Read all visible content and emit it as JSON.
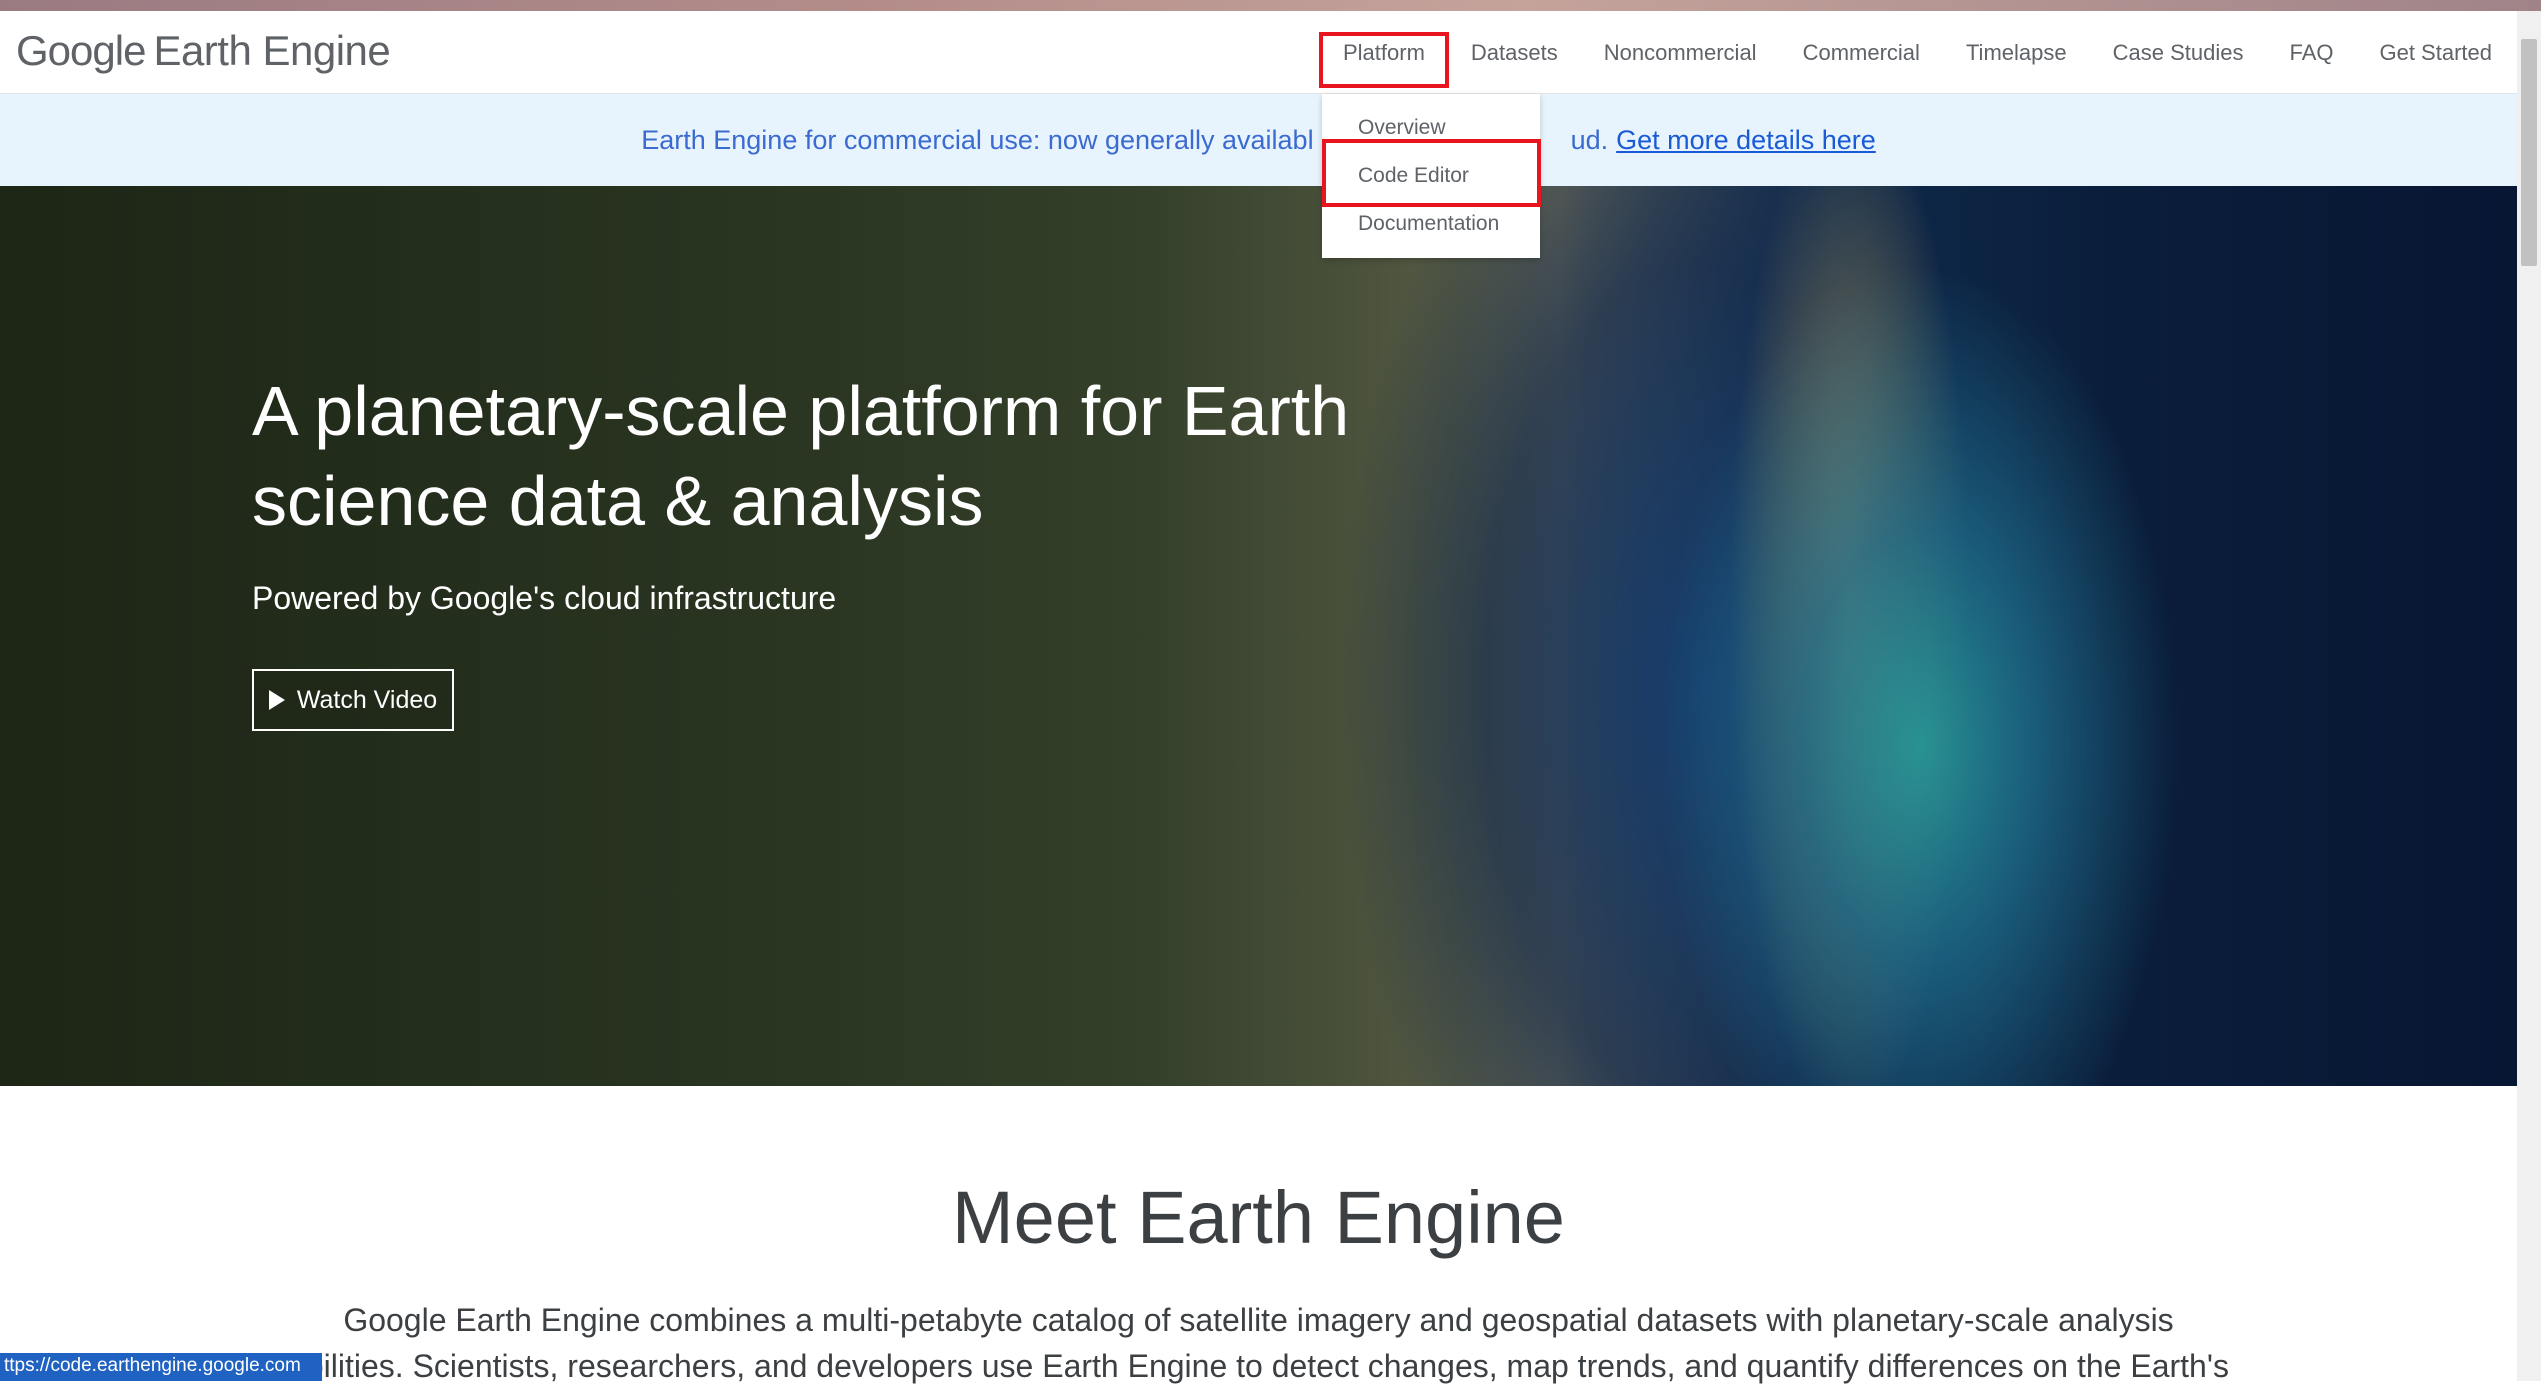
{
  "header": {
    "logo_google": "Google",
    "logo_product": "Earth Engine",
    "nav": [
      "Platform",
      "Datasets",
      "Noncommercial",
      "Commercial",
      "Timelapse",
      "Case Studies",
      "FAQ",
      "Get Started"
    ]
  },
  "banner": {
    "text": "Earth Engine for commercial use: now generally availabl",
    "tail": "ud.",
    "link": "Get more details here"
  },
  "dropdown": {
    "items": [
      "Overview",
      "Code Editor",
      "Documentation"
    ]
  },
  "hero": {
    "title_line1": "A planetary-scale platform for Earth",
    "title_line2": "science data & analysis",
    "subtitle": "Powered by Google's cloud infrastructure",
    "watch_video": "Watch Video"
  },
  "meet": {
    "title": "Meet Earth Engine",
    "line1": "Google Earth Engine combines a multi-petabyte catalog of satellite imagery and geospatial datasets with planetary-scale analysis",
    "line2": "abilities. Scientists, researchers, and developers use Earth Engine to detect changes, map trends, and quantify differences on the Earth's"
  },
  "status_bar": {
    "url": "ttps://code.earthengine.google.com"
  },
  "colors": {
    "accent_link": "#1a5ad6",
    "highlight_box": "#e8141e",
    "banner_bg": "#e8f4fd"
  }
}
